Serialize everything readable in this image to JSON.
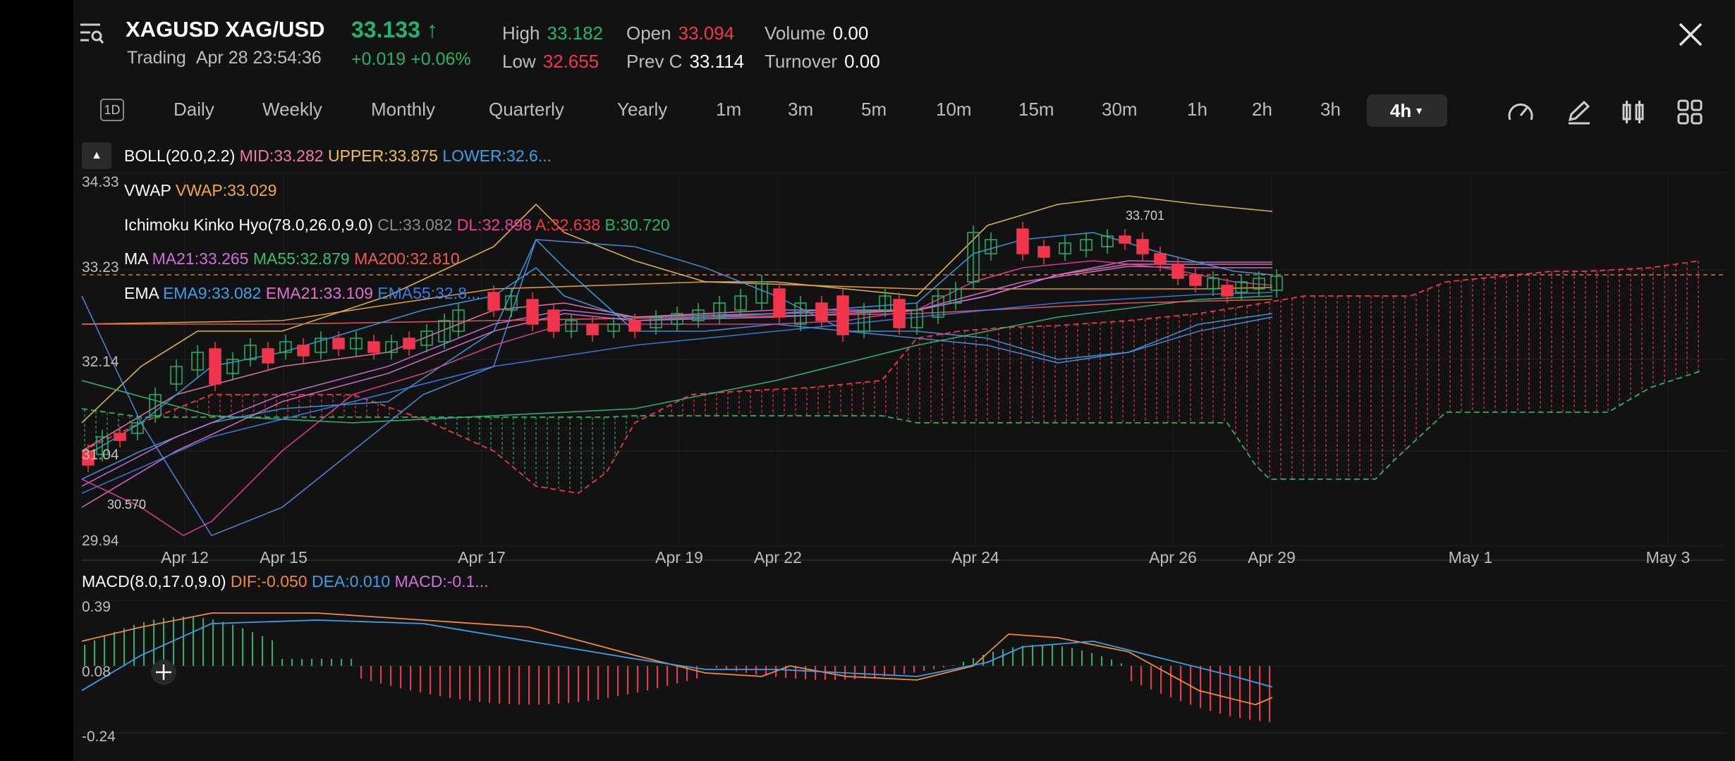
{
  "header": {
    "symbol": "XAGUSD XAG/USD",
    "price": "33.133",
    "price_arrow": "↑",
    "status": "Trading",
    "datetime": "Apr 28 23:54:36",
    "change": "+0.019",
    "change_pct": "+0.06%",
    "stats": [
      {
        "key": "High",
        "value": "33.182",
        "color": "#21b46a"
      },
      {
        "key": "Low",
        "value": "32.655",
        "color": "#f0364c"
      },
      {
        "key": "Open",
        "value": "33.094",
        "color": "#f0364c"
      },
      {
        "key": "Prev C",
        "value": "33.114",
        "color": "#ffffff"
      },
      {
        "key": "Volume",
        "value": "0.00",
        "color": "#ffffff"
      },
      {
        "key": "Turnover",
        "value": "0.00",
        "color": "#ffffff"
      }
    ],
    "menu_icon": "list-search-icon",
    "close_icon": "close-icon"
  },
  "timeframes": {
    "badge": "1D",
    "items": [
      "Daily",
      "Weekly",
      "Monthly",
      "Quarterly",
      "Yearly",
      "1m",
      "3m",
      "5m",
      "10m",
      "15m",
      "30m",
      "1h",
      "2h",
      "3h"
    ],
    "selected": "4h",
    "tools": [
      "gauge-icon",
      "pencil-icon",
      "candle-icon",
      "grid-icon"
    ]
  },
  "indicators": {
    "boll": {
      "name": "BOLL(20.0,2.2)",
      "mid": "MID:33.282",
      "upper": "UPPER:33.875",
      "lower": "LOWER:32.6..."
    },
    "vwap": {
      "name": "VWAP",
      "value": "VWAP:33.029"
    },
    "ichimoku": {
      "name": "Ichimoku Kinko Hyo(78.0,26.0,9.0)",
      "cl": "CL:33.082",
      "dl": "DL:32.898",
      "a": "A:32.638",
      "b": "B:30.720"
    },
    "ma": {
      "name": "MA",
      "ma21": "MA21:33.265",
      "ma55": "MA55:32.879",
      "ma200": "MA200:32.810"
    },
    "ema": {
      "name": "EMA",
      "ema9": "EMA9:33.082",
      "ema21": "EMA21:33.109",
      "ema55": "EMA55:32.8..."
    }
  },
  "colors": {
    "up": "#21b46a",
    "down": "#f0364c",
    "boll_mid": "#f07aa8",
    "boll_upper": "#f2c14e",
    "boll_lower": "#3aa0e8",
    "vwap": "#f2a93b",
    "cl": "#8a8a8a",
    "dl": "#e8409a",
    "a": "#f0364c",
    "b": "#21b46a",
    "ma21": "#d070e0",
    "ma55": "#2ec07a",
    "ma200": "#f05a5a",
    "ema9": "#3aa0e8",
    "ema21": "#e070d0",
    "ema55": "#3a7ee8",
    "dif": "#f08a3a",
    "dea": "#3aa0e8",
    "macd": "#d070e0"
  },
  "chart_data": {
    "type": "candlestick",
    "y_ticks": [
      "34.33",
      "33.23",
      "32.14",
      "31.04",
      "29.94"
    ],
    "x_ticks": [
      "Apr 12",
      "Apr 15",
      "Apr 17",
      "Apr 19",
      "Apr 22",
      "Apr 24",
      "Apr 26",
      "Apr 29",
      "May 1",
      "May 3"
    ],
    "ylim": [
      29.94,
      34.33
    ],
    "annotations": [
      {
        "text": "33.701"
      },
      {
        "text": "30.570"
      }
    ],
    "current_price": 33.133,
    "macd": {
      "label": "MACD(8.0,17.0,9.0)",
      "dif": "DIF:-0.050",
      "dea": "DEA:0.010",
      "macd": "MACD:-0.1...",
      "y_ticks": [
        "0.39",
        "0.08",
        "-0.24"
      ],
      "ylim": [
        -0.24,
        0.39
      ]
    }
  }
}
